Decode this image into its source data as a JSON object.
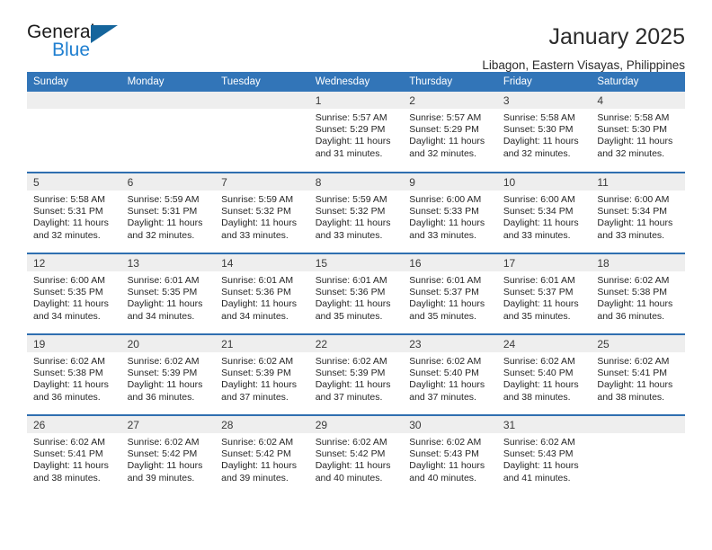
{
  "brand": {
    "name_part1": "General",
    "name_part2": "Blue",
    "accent_color": "#1f7fd0",
    "triangle_color": "#15659c"
  },
  "header": {
    "title": "January 2025",
    "subtitle": "Libagon, Eastern Visayas, Philippines"
  },
  "calendar": {
    "header_bg": "#3275b8",
    "row_border": "#2f6fb0",
    "daynum_bg": "#eeeeee",
    "weekdays": [
      "Sunday",
      "Monday",
      "Tuesday",
      "Wednesday",
      "Thursday",
      "Friday",
      "Saturday"
    ],
    "weeks": [
      [
        {
          "day": "",
          "empty": true
        },
        {
          "day": "",
          "empty": true
        },
        {
          "day": "",
          "empty": true
        },
        {
          "day": "1",
          "sunrise": "Sunrise: 5:57 AM",
          "sunset": "Sunset: 5:29 PM",
          "daylight": "Daylight: 11 hours and 31 minutes."
        },
        {
          "day": "2",
          "sunrise": "Sunrise: 5:57 AM",
          "sunset": "Sunset: 5:29 PM",
          "daylight": "Daylight: 11 hours and 32 minutes."
        },
        {
          "day": "3",
          "sunrise": "Sunrise: 5:58 AM",
          "sunset": "Sunset: 5:30 PM",
          "daylight": "Daylight: 11 hours and 32 minutes."
        },
        {
          "day": "4",
          "sunrise": "Sunrise: 5:58 AM",
          "sunset": "Sunset: 5:30 PM",
          "daylight": "Daylight: 11 hours and 32 minutes."
        }
      ],
      [
        {
          "day": "5",
          "sunrise": "Sunrise: 5:58 AM",
          "sunset": "Sunset: 5:31 PM",
          "daylight": "Daylight: 11 hours and 32 minutes."
        },
        {
          "day": "6",
          "sunrise": "Sunrise: 5:59 AM",
          "sunset": "Sunset: 5:31 PM",
          "daylight": "Daylight: 11 hours and 32 minutes."
        },
        {
          "day": "7",
          "sunrise": "Sunrise: 5:59 AM",
          "sunset": "Sunset: 5:32 PM",
          "daylight": "Daylight: 11 hours and 33 minutes."
        },
        {
          "day": "8",
          "sunrise": "Sunrise: 5:59 AM",
          "sunset": "Sunset: 5:32 PM",
          "daylight": "Daylight: 11 hours and 33 minutes."
        },
        {
          "day": "9",
          "sunrise": "Sunrise: 6:00 AM",
          "sunset": "Sunset: 5:33 PM",
          "daylight": "Daylight: 11 hours and 33 minutes."
        },
        {
          "day": "10",
          "sunrise": "Sunrise: 6:00 AM",
          "sunset": "Sunset: 5:34 PM",
          "daylight": "Daylight: 11 hours and 33 minutes."
        },
        {
          "day": "11",
          "sunrise": "Sunrise: 6:00 AM",
          "sunset": "Sunset: 5:34 PM",
          "daylight": "Daylight: 11 hours and 33 minutes."
        }
      ],
      [
        {
          "day": "12",
          "sunrise": "Sunrise: 6:00 AM",
          "sunset": "Sunset: 5:35 PM",
          "daylight": "Daylight: 11 hours and 34 minutes."
        },
        {
          "day": "13",
          "sunrise": "Sunrise: 6:01 AM",
          "sunset": "Sunset: 5:35 PM",
          "daylight": "Daylight: 11 hours and 34 minutes."
        },
        {
          "day": "14",
          "sunrise": "Sunrise: 6:01 AM",
          "sunset": "Sunset: 5:36 PM",
          "daylight": "Daylight: 11 hours and 34 minutes."
        },
        {
          "day": "15",
          "sunrise": "Sunrise: 6:01 AM",
          "sunset": "Sunset: 5:36 PM",
          "daylight": "Daylight: 11 hours and 35 minutes."
        },
        {
          "day": "16",
          "sunrise": "Sunrise: 6:01 AM",
          "sunset": "Sunset: 5:37 PM",
          "daylight": "Daylight: 11 hours and 35 minutes."
        },
        {
          "day": "17",
          "sunrise": "Sunrise: 6:01 AM",
          "sunset": "Sunset: 5:37 PM",
          "daylight": "Daylight: 11 hours and 35 minutes."
        },
        {
          "day": "18",
          "sunrise": "Sunrise: 6:02 AM",
          "sunset": "Sunset: 5:38 PM",
          "daylight": "Daylight: 11 hours and 36 minutes."
        }
      ],
      [
        {
          "day": "19",
          "sunrise": "Sunrise: 6:02 AM",
          "sunset": "Sunset: 5:38 PM",
          "daylight": "Daylight: 11 hours and 36 minutes."
        },
        {
          "day": "20",
          "sunrise": "Sunrise: 6:02 AM",
          "sunset": "Sunset: 5:39 PM",
          "daylight": "Daylight: 11 hours and 36 minutes."
        },
        {
          "day": "21",
          "sunrise": "Sunrise: 6:02 AM",
          "sunset": "Sunset: 5:39 PM",
          "daylight": "Daylight: 11 hours and 37 minutes."
        },
        {
          "day": "22",
          "sunrise": "Sunrise: 6:02 AM",
          "sunset": "Sunset: 5:39 PM",
          "daylight": "Daylight: 11 hours and 37 minutes."
        },
        {
          "day": "23",
          "sunrise": "Sunrise: 6:02 AM",
          "sunset": "Sunset: 5:40 PM",
          "daylight": "Daylight: 11 hours and 37 minutes."
        },
        {
          "day": "24",
          "sunrise": "Sunrise: 6:02 AM",
          "sunset": "Sunset: 5:40 PM",
          "daylight": "Daylight: 11 hours and 38 minutes."
        },
        {
          "day": "25",
          "sunrise": "Sunrise: 6:02 AM",
          "sunset": "Sunset: 5:41 PM",
          "daylight": "Daylight: 11 hours and 38 minutes."
        }
      ],
      [
        {
          "day": "26",
          "sunrise": "Sunrise: 6:02 AM",
          "sunset": "Sunset: 5:41 PM",
          "daylight": "Daylight: 11 hours and 38 minutes."
        },
        {
          "day": "27",
          "sunrise": "Sunrise: 6:02 AM",
          "sunset": "Sunset: 5:42 PM",
          "daylight": "Daylight: 11 hours and 39 minutes."
        },
        {
          "day": "28",
          "sunrise": "Sunrise: 6:02 AM",
          "sunset": "Sunset: 5:42 PM",
          "daylight": "Daylight: 11 hours and 39 minutes."
        },
        {
          "day": "29",
          "sunrise": "Sunrise: 6:02 AM",
          "sunset": "Sunset: 5:42 PM",
          "daylight": "Daylight: 11 hours and 40 minutes."
        },
        {
          "day": "30",
          "sunrise": "Sunrise: 6:02 AM",
          "sunset": "Sunset: 5:43 PM",
          "daylight": "Daylight: 11 hours and 40 minutes."
        },
        {
          "day": "31",
          "sunrise": "Sunrise: 6:02 AM",
          "sunset": "Sunset: 5:43 PM",
          "daylight": "Daylight: 11 hours and 41 minutes."
        },
        {
          "day": "",
          "empty": true
        }
      ]
    ]
  }
}
